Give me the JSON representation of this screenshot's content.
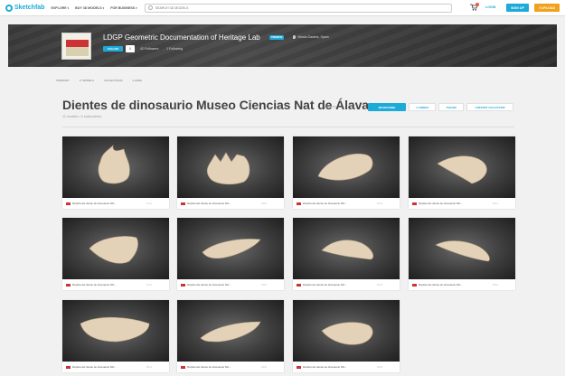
{
  "header": {
    "logo_text": "Sketchfab",
    "nav": [
      "EXPLORE",
      "BUY 3D MODELS",
      "FOR BUSINESS"
    ],
    "search_placeholder": "SEARCH 3D MODELS",
    "login": "LOGIN",
    "signup": "SIGN UP",
    "upload": "UPLOAD"
  },
  "profile": {
    "name": "LDGP Geometric Documentation of Heritage Lab",
    "badge": "PREMIUM",
    "location": "Vitoria-Gasteiz, Spain",
    "follow_label": "FOLLOW",
    "follow_count": "0",
    "followers": "42 Followers",
    "following": "1 Following"
  },
  "tabs": [
    "SUMMARY",
    "17 MODELS",
    "COLLECTIONS",
    "4 LIKES"
  ],
  "collection": {
    "title": "Dientes de dinosaurio Museo Ciencias Nat de Álava",
    "models_count": "11 models",
    "subtitle": "11 models • 0 subscribers",
    "subscribe": "SUBSCRIBE",
    "embed": "EMBED",
    "share": "SHARE",
    "report": "REPORT COLLECTION"
  },
  "cards": [
    {
      "name": "Réplica del diente de dinosaurio MC...",
      "stats": "1  0  1"
    },
    {
      "name": "Réplica del diente de dinosaurio MC...",
      "stats": "0  0  0"
    },
    {
      "name": "Réplica del diente de dinosaurio MC...",
      "stats": "0  0  0"
    },
    {
      "name": "Réplica del diente de dinosaurio MC...",
      "stats": "0  0  1"
    },
    {
      "name": "Réplica del diente de dinosaurio MC...",
      "stats": "1  0  1"
    },
    {
      "name": "Réplica del diente de dinosaurio MC...",
      "stats": "0  0  0"
    },
    {
      "name": "Réplica del diente de dinosaurio MC...",
      "stats": "0  0  0"
    },
    {
      "name": "Réplica del diente de dinosaurio MC...",
      "stats": "0  0  0"
    },
    {
      "name": "Réplica del diente de dinosaurio MC...",
      "stats": "0  0  1"
    },
    {
      "name": "Réplica del diente de dinosaurio MC...",
      "stats": "0  0  0"
    },
    {
      "name": "Réplica del diente de dinosaurio MC...",
      "stats": "0  0  0"
    }
  ],
  "colors": {
    "accent": "#1caad9",
    "upload": "#f1a11b",
    "tooth": "#e3d2b8"
  }
}
